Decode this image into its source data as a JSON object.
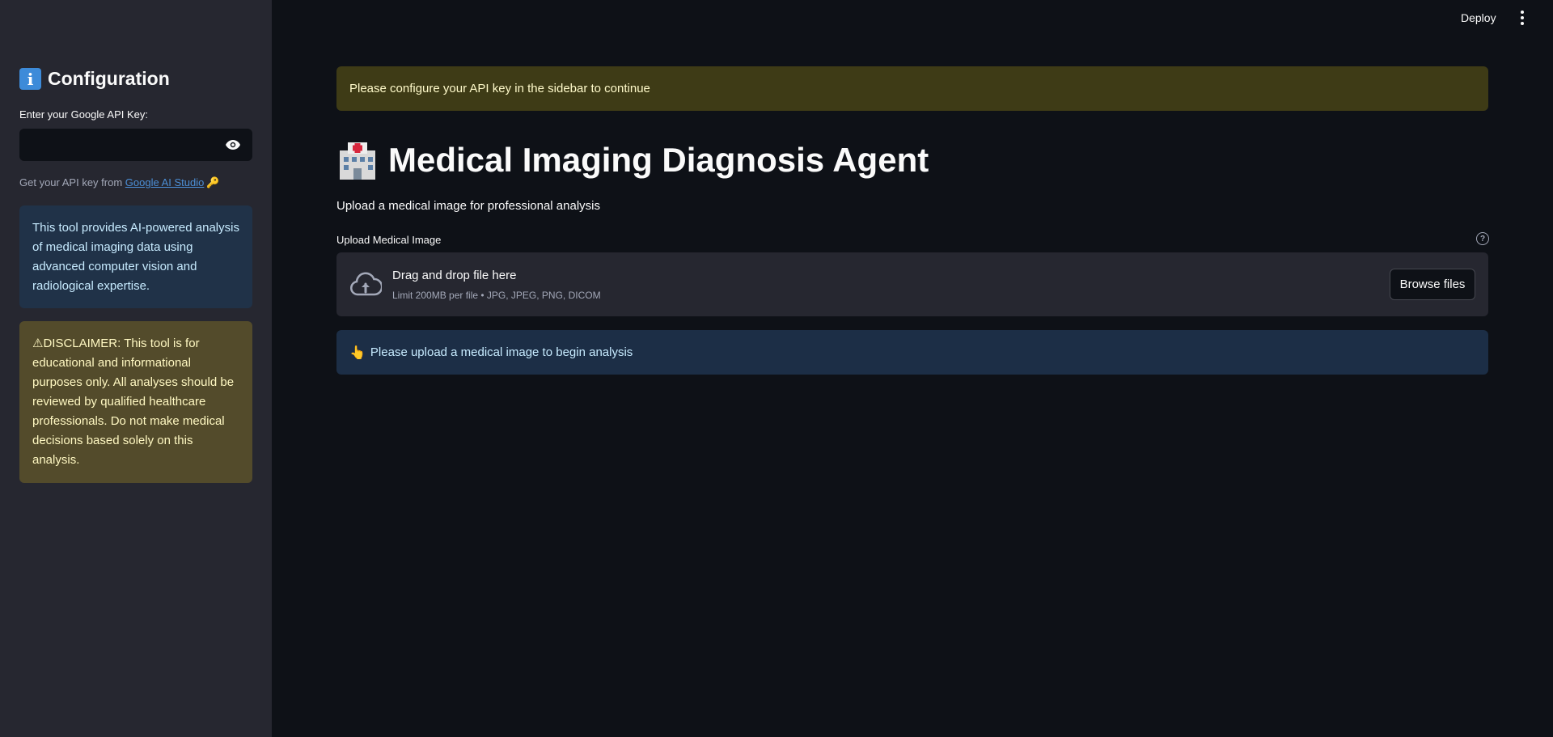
{
  "sidebar": {
    "title": "Configuration",
    "title_icon": "information-icon",
    "api_key_label": "Enter your Google API Key:",
    "api_key_value": "",
    "help_prefix": "Get your API key from ",
    "help_link": "Google AI Studio",
    "help_suffix_icon": "🔑",
    "info_text": "This tool provides AI-powered analysis of medical imaging data using advanced computer vision and radiological expertise.",
    "disclaimer_text": "⚠DISCLAIMER: This tool is for educational and informational purposes only. All analyses should be reviewed by qualified healthcare professionals. Do not make medical decisions based solely on this analysis."
  },
  "header": {
    "deploy_label": "Deploy",
    "menu_icon": "vertical-dots-icon"
  },
  "main": {
    "config_warning": "Please configure your API key in the sidebar to continue",
    "title": "Medical Imaging Diagnosis Agent",
    "title_icon": "hospital-icon",
    "subtitle": "Upload a medical image for professional analysis",
    "upload": {
      "label": "Upload Medical Image",
      "help_icon": "question-circle-icon",
      "drop_text": "Drag and drop file here",
      "limit_text": "Limit 200MB per file • JPG, JPEG, PNG, DICOM",
      "browse_label": "Browse files",
      "icon": "cloud-upload-icon"
    },
    "info_icon": "👆",
    "info_message": "Please upload a medical image to begin analysis"
  },
  "colors": {
    "background": "#0e1117",
    "sidebar": "#262730",
    "warning_bg": "#3e3b16",
    "info_bg": "#1c2e46",
    "link": "#4c8fd6"
  }
}
